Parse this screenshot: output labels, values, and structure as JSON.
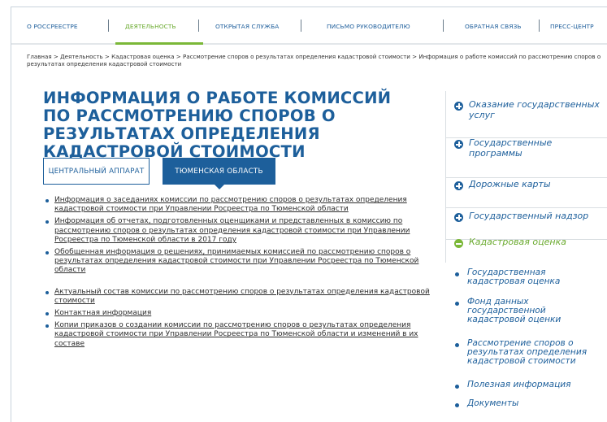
{
  "topnav": {
    "items": [
      {
        "label": "О РОССРЕЕСТРЕ",
        "active": false
      },
      {
        "label": "ДЕЯТЕЛЬНОСТЬ",
        "active": true
      },
      {
        "label": "ОТКРЫТАЯ СЛУЖБА",
        "active": false
      },
      {
        "label": "ПИСЬМО РУКОВОДИТЕЛЮ",
        "active": false
      },
      {
        "label": "ОБРАТНАЯ СВЯЗЬ",
        "active": false
      },
      {
        "label": "ПРЕСС-ЦЕНТР",
        "active": false
      }
    ],
    "accent_color": "#7bb838"
  },
  "breadcrumb": "Главная > Деятельность > Кадастровая оценка > Рассмотрение споров о результатах определения кадастровой стоимости > Информация о работе комиссий по рассмотрению споров о результатах определения кадастровой стоимости",
  "page_title": "ИНФОРМАЦИЯ О РАБОТЕ КОМИССИЙ ПО РАССМОТРЕНИЮ СПОРОВ О РЕЗУЛЬТАТАХ ОПРЕДЕЛЕНИЯ КАДАСТРОВОЙ СТОИМОСТИ",
  "tabs": {
    "central": "ЦЕНТРАЛЬНЫЙ АППАРАТ",
    "tyumen": "ТЮМЕНСКАЯ ОБЛАСТЬ",
    "selected": "tyumen"
  },
  "documents": [
    "Информация о заседаниях комиссии по рассмотрению споров о результатах определения кадастровой стоимости при Управлении Росреестра по Тюменской области",
    "Информация об отчетах, подготовленных оценщиками и представленных в комиссию по рассмотрению споров о результатах определения кадастровой стоимости при Управлении Росреестра по Тюменской области в 2017 году",
    "Обобщенная информация о решениях, принимаемых комиссией по рассмотрению споров о результатах определения кадастровой стоимости при Управлении Росреестра по Тюменской области",
    "Актуальный состав комиссии по рассмотрению споров о результатах определения кадастровой стоимости",
    "Контактная информация",
    "Копии приказов о создании комиссии по рассмотрению споров о результатах определения кадастровой стоимости при Управлении Росреестра по Тюменской области и изменений в их составе"
  ],
  "sidebar": {
    "items": [
      {
        "label": "Оказание государственных услуг",
        "expanded": false
      },
      {
        "label": "Государственные программы",
        "expanded": false
      },
      {
        "label": "Дорожные карты",
        "expanded": false
      },
      {
        "label": "Государственный надзор",
        "expanded": false
      },
      {
        "label": "Кадастровая оценка",
        "expanded": true
      }
    ],
    "subitems": [
      "Государственная кадастровая оценка",
      "Фонд данных государственной кадастровой оценки",
      "Рассмотрение споров о результатах определения кадастровой стоимости",
      "Полезная информация",
      "Документы"
    ]
  },
  "colors": {
    "brand_blue": "#1d5f9b",
    "active_green": "#6aaa2e"
  }
}
